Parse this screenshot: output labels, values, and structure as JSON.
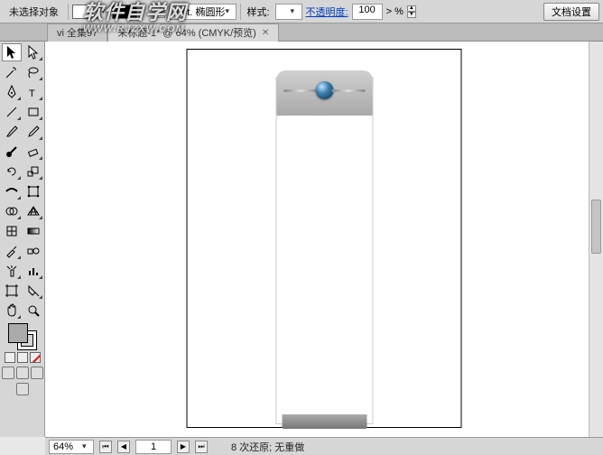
{
  "options_bar": {
    "selection_status": "未选择对象",
    "stroke_weight": "2 pt. 椭圆形",
    "style_label": "样式:",
    "opacity_label": "不透明度:",
    "opacity_value": "100",
    "opacity_unit": "%",
    "doc_setup_btn": "文档设置"
  },
  "doc_tabs": {
    "tab1": "vi 全集97",
    "tab2": "未标题-1* @ 64% (CMYK/预览)"
  },
  "watermark": {
    "zh": "软件自学网",
    "en": "WWW.RJZXW.COM"
  },
  "status_bar": {
    "zoom": "64%",
    "page": "1",
    "undo_info": "8 次还原;  无重做"
  },
  "icons": {
    "dd": "▾",
    "first": "⏮",
    "prev": "◀",
    "next": "▶",
    "last": "⏭",
    "spin_up": "▲",
    "spin_dn": "▼",
    "close": "✕"
  }
}
